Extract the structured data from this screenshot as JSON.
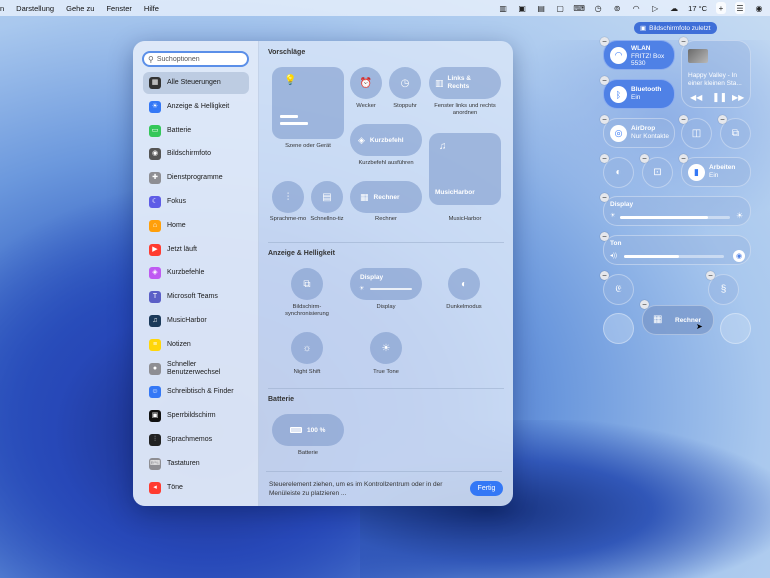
{
  "menubar": {
    "items": [
      "n",
      "Darstellung",
      "Gehe zu",
      "Fenster",
      "Hilfe"
    ],
    "status_icons": [
      "suitcase-icon",
      "tv-icon",
      "phone-icon",
      "display-icon",
      "input-icon",
      "timer-icon",
      "broadcast-icon",
      "wifi-icon",
      "play-icon",
      "weather-cloud-icon",
      "plus-icon",
      "control-center-icon",
      "siri-icon"
    ],
    "temperature": "17 °C"
  },
  "toast": {
    "label": "Bildschirmfoto zuletzt"
  },
  "search": {
    "placeholder": "Suchoptionen"
  },
  "sidebar": {
    "items": [
      {
        "label": "Alle Steuerungen",
        "icon": "grid-icon",
        "color": "#333333"
      },
      {
        "label": "Anzeige & Helligkeit",
        "icon": "sun-icon",
        "color": "#3478f6"
      },
      {
        "label": "Batterie",
        "icon": "battery-icon",
        "color": "#34c759"
      },
      {
        "label": "Bildschirmfoto",
        "icon": "camera-icon",
        "color": "#555555"
      },
      {
        "label": "Dienstprogramme",
        "icon": "tools-icon",
        "color": "#8e8e93"
      },
      {
        "label": "Fokus",
        "icon": "moon-icon",
        "color": "#5e5ce6"
      },
      {
        "label": "Home",
        "icon": "house-icon",
        "color": "#ff9f0a"
      },
      {
        "label": "Jetzt läuft",
        "icon": "play-icon",
        "color": "#ff3b30"
      },
      {
        "label": "Kurzbefehle",
        "icon": "shortcuts-icon",
        "color": "#bf5af2"
      },
      {
        "label": "Microsoft Teams",
        "icon": "teams-icon",
        "color": "#5b5fc7"
      },
      {
        "label": "MusicHarbor",
        "icon": "musicharbor-icon",
        "color": "#1c3a5a"
      },
      {
        "label": "Notizen",
        "icon": "notes-icon",
        "color": "#ffd60a"
      },
      {
        "label": "Schneller Benutzerwechsel",
        "icon": "user-icon",
        "color": "#8e8e93"
      },
      {
        "label": "Schreibtisch & Finder",
        "icon": "finder-icon",
        "color": "#3478f6"
      },
      {
        "label": "Sperrbildschirm",
        "icon": "lock-icon",
        "color": "#111111"
      },
      {
        "label": "Sprachmemos",
        "icon": "waveform-icon",
        "color": "#222222"
      },
      {
        "label": "Tastaturen",
        "icon": "keyboard-icon",
        "color": "#8e8e93"
      },
      {
        "label": "Töne",
        "icon": "speaker-icon",
        "color": "#ff3b30"
      }
    ]
  },
  "content": {
    "vorschlaege_title": "Vorschläge",
    "szene_label": "Szene oder Gerät",
    "wecker_label": "Wecker",
    "stoppuhr_label": "Stoppuhr",
    "links_rechts_title": "Links & Rechts",
    "links_rechts_label": "Fenster links und rechts anordnen",
    "kurzbefehl_title": "Kurzbefehl",
    "kurzbefehl_label": "Kurzbefehl ausführen",
    "musicharbor_title": "MusicHarbor",
    "musicharbor_label": "MusicHarbor",
    "sprachmemo_label": "Sprachme-mo",
    "schnellnotiz_label": "Schnellno-tiz",
    "rechner_title": "Rechner",
    "rechner_label": "Rechner",
    "anzeige_title": "Anzeige & Helligkeit",
    "sync_label": "Bildschirm-synchronisierung",
    "display_title": "Display",
    "display_label": "Display",
    "dunkel_label": "Dunkelmodus",
    "nightshift_label": "Night Shift",
    "truetone_label": "True Tone",
    "batterie_title": "Batterie",
    "battery_value": "100 %",
    "battery_label": "Batterie",
    "footer": "Steuerelement ziehen, um es im Kontrollzentrum oder in der Menüleiste zu platzieren ...",
    "done": "Fertig"
  },
  "cc": {
    "wlan_title": "WLAN",
    "wlan_sub": "FRITZ! Box 5530",
    "bt_title": "Bluetooth",
    "bt_sub": "Ein",
    "airdrop_title": "AirDrop",
    "airdrop_sub": "Nur Kontakte",
    "now_playing": "Happy Valley - In einer kleinen Sta...",
    "arbeiten_title": "Arbeiten",
    "arbeiten_sub": "Ein",
    "display_title": "Display",
    "display_level": 0.8,
    "ton_title": "Ton",
    "ton_level": 0.55,
    "rechner_drag": "Rechner"
  }
}
